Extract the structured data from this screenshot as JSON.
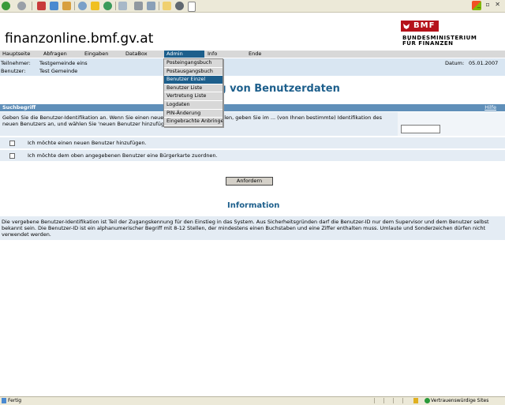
{
  "site": {
    "title": "finanzonline.bmf.gv.at"
  },
  "logo": {
    "abbr": "BMF",
    "line1": "BUNDESMINISTERIUM",
    "line2": "FÜR FINANZEN"
  },
  "nav": {
    "items": [
      "Hauptseite",
      "Abfragen",
      "Eingaben",
      "DataBox",
      "Admin",
      "Info",
      "Ende"
    ],
    "active": "Admin"
  },
  "info": {
    "participant_label": "Teilnehmer:",
    "participant_value": "Testgemeinde eins",
    "user_label": "Benutzer:",
    "user_value": "Test Gemeinde",
    "date_label": "Datum:",
    "date_value": "05.01.2007"
  },
  "page": {
    "heading": "ng von Benutzerdaten"
  },
  "form": {
    "search_label": "Suchbegriff",
    "help_label": "Hilfe",
    "instructions": "Geben Sie die Benutzer-Identifikation an. Wenn Sie einen neuen Benutzer anlegen wollen, geben Sie im ... (von Ihnen bestimmte) Identifikation des neuen Benutzers an, und wählen Sie 'neuen Benutzer hinzufügen'.",
    "user_id_value": "",
    "add_user_label": "Ich möchte einen neuen Benutzer hinzufügen.",
    "assign_card_label": "Ich möchte dem oben angegebenen Benutzer eine Bürgerkarte zuordnen.",
    "request_button": "Anfordern"
  },
  "information": {
    "heading": "Information",
    "text": "Die vergebene Benutzer-Identifikation ist Teil der Zugangskennung für den Einstieg in das System. Aus Sicherheitsgründen darf die Benutzer-ID nur dem Supervisor und dem Benutzer selbst bekannt sein. Die Benutzer-ID ist ein alphanumerischer Begriff mit 8-12 Stellen, der mindestens einen Buchstaben und eine Ziffer enthalten muss. Umlaute und Sonderzeichen dürfen nicht verwendet werden."
  },
  "admin_menu": {
    "items": [
      "Posteingangsbuch",
      "Postausgangsbuch",
      "Benutzer Einzel",
      "Benutzer Liste",
      "Vertretung Liste",
      "Logdaten",
      "PIN-Änderung",
      "Eingebrachte Anbringen"
    ],
    "highlighted": "Benutzer Einzel"
  },
  "statusbar": {
    "status": "Fertig",
    "zone": "Vertrauenswürdige Sites"
  },
  "colors": {
    "accent": "#1d5f8c",
    "brand": "#b5121b",
    "panel": "#e4ecf4",
    "header_bar": "#5f8fb9"
  },
  "icons": [
    "back-icon",
    "forward-icon",
    "stop-icon",
    "refresh-icon",
    "home-icon",
    "search-icon",
    "favorites-icon",
    "history-icon",
    "mail-icon",
    "print-icon",
    "edit-icon",
    "messenger-icon"
  ]
}
